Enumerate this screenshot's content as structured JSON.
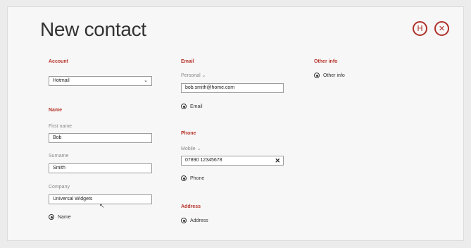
{
  "header": {
    "title": "New contact",
    "save_icon": "H",
    "cancel_icon": "✕"
  },
  "account": {
    "heading": "Account",
    "value": "Hotmail",
    "chevron": "⌄"
  },
  "name": {
    "heading": "Name",
    "first_label": "First name",
    "first_value": "Bob",
    "surname_label": "Surname",
    "surname_value": "Smith",
    "company_label": "Company",
    "company_value": "Universal Widgets",
    "add_label": "Name"
  },
  "email": {
    "heading": "Email",
    "type_label": "Personal ⌄",
    "value": "bob.smith@home.com",
    "add_label": "Email"
  },
  "phone": {
    "heading": "Phone",
    "type_label": "Mobile ⌄",
    "value": "07890 12345678",
    "clear": "✕",
    "add_label": "Phone"
  },
  "address": {
    "heading": "Address",
    "add_label": "Address"
  },
  "other": {
    "heading": "Other info",
    "add_label": "Other info"
  }
}
